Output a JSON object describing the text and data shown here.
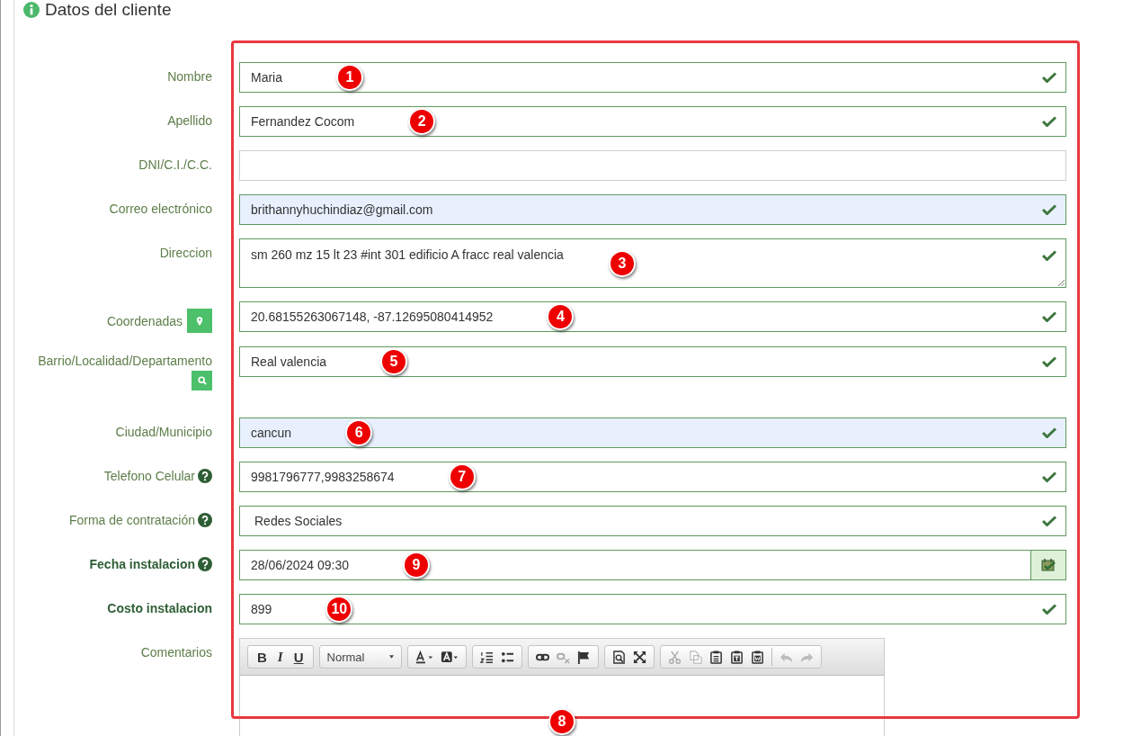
{
  "section": {
    "title": "Datos del cliente"
  },
  "fields": [
    {
      "label": "Nombre",
      "kind": "input",
      "value": "Maria",
      "valid": true,
      "autofill": false,
      "label_bold": false,
      "help": false,
      "pin_button": false,
      "search_button": false,
      "marker": "1"
    },
    {
      "label": "Apellido",
      "kind": "input",
      "value": "Fernandez Cocom",
      "valid": true,
      "autofill": false,
      "label_bold": false,
      "help": false,
      "pin_button": false,
      "search_button": false,
      "marker": "2"
    },
    {
      "label": "DNI/C.I./C.C.",
      "kind": "input",
      "valid": false,
      "autofill": false,
      "label_bold": false,
      "help": false,
      "pin_button": false,
      "search_button": false
    },
    {
      "label": "Correo electrónico",
      "kind": "input",
      "value": "brithannyhuchindiaz@gmail.com",
      "valid": true,
      "autofill": true,
      "label_bold": false,
      "help": false,
      "pin_button": false,
      "search_button": false
    },
    {
      "label": "Direccion",
      "kind": "textarea",
      "value": "sm 260 mz 15 lt 23 #int 301 edificio A fracc real valencia",
      "valid": true,
      "autofill": false,
      "label_bold": false,
      "help": false,
      "pin_button": false,
      "search_button": false,
      "marker": "3"
    },
    {
      "label": "Coordenadas",
      "kind": "input",
      "value": "20.68155263067148, -87.12695080414952",
      "valid": true,
      "autofill": false,
      "label_bold": false,
      "help": false,
      "pin_button": true,
      "search_button": false,
      "marker": "4"
    },
    {
      "label": "Barrio/Localidad/Departamento",
      "kind": "input",
      "value": "Real valencia",
      "valid": true,
      "autofill": false,
      "label_bold": false,
      "help": false,
      "pin_button": false,
      "search_button": true,
      "marker": "5"
    },
    {
      "label": "Ciudad/Municipio",
      "kind": "input",
      "value": "cancun",
      "valid": true,
      "autofill": true,
      "label_bold": false,
      "help": false,
      "pin_button": false,
      "search_button": false,
      "marker": "6"
    },
    {
      "label": "Telefono Celular",
      "kind": "input",
      "value": "9981796777,9983258674",
      "valid": true,
      "autofill": false,
      "label_bold": false,
      "help": true,
      "pin_button": false,
      "search_button": false,
      "marker": "7"
    },
    {
      "label": "Forma de contratación",
      "kind": "select",
      "value": "Redes Sociales",
      "valid": true,
      "autofill": false,
      "label_bold": false,
      "help": true,
      "pin_button": false,
      "search_button": false
    },
    {
      "label": "Fecha instalacion",
      "kind": "date",
      "value": "28/06/2024 09:30",
      "valid": true,
      "autofill": false,
      "label_bold": true,
      "help": true,
      "pin_button": false,
      "search_button": false,
      "marker": "9"
    },
    {
      "label": "Costo instalacion",
      "kind": "input",
      "value": "899",
      "valid": true,
      "autofill": false,
      "label_bold": true,
      "help": false,
      "pin_button": false,
      "search_button": false,
      "marker": "10"
    }
  ],
  "comments": {
    "label": "Comentarios",
    "format": "Normal",
    "bold": "B",
    "italic": "I",
    "underline": "U",
    "marker": "8"
  }
}
